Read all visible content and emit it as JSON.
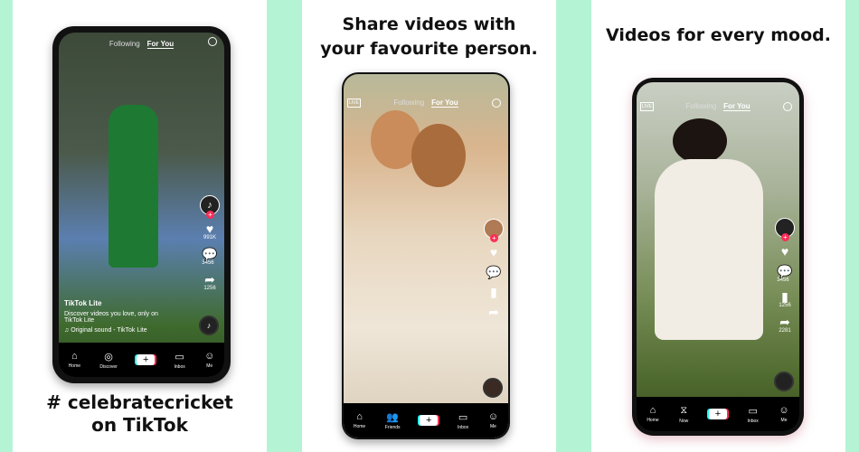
{
  "panels": [
    {
      "caption_lines": [
        "# celebratecricket",
        "on TikTok"
      ],
      "topnav": {
        "following": "Following",
        "for_you": "For You"
      },
      "side": {
        "likes": "991K",
        "comments": "3456",
        "shares": "1256"
      },
      "post": {
        "author": "TikTok Lite",
        "description": "Discover videos you love, only on TikTok Lite",
        "sound": "♫ Original sound - TikTok Lite"
      },
      "tabs": [
        "Home",
        "Discover",
        "Inbox",
        "Me"
      ]
    },
    {
      "caption_lines": [
        "Share videos with",
        "your favourite person."
      ],
      "topnav": {
        "live": "LIVE",
        "following": "Following",
        "for_you": "For You"
      },
      "tabs": [
        "Home",
        "Friends",
        "Inbox",
        "Me"
      ]
    },
    {
      "caption_lines": [
        "Videos for every mood."
      ],
      "topnav": {
        "live": "LIVE",
        "following": "Following",
        "for_you": "For You"
      },
      "side": {
        "comments": "3456",
        "saves": "1256",
        "shares": "2281"
      },
      "tabs": [
        "Home",
        "Now",
        "Inbox",
        "Me"
      ]
    }
  ],
  "colors": {
    "background": "#b4f4d4",
    "accent": "#fe2c55",
    "cyan": "#25f4ee"
  }
}
